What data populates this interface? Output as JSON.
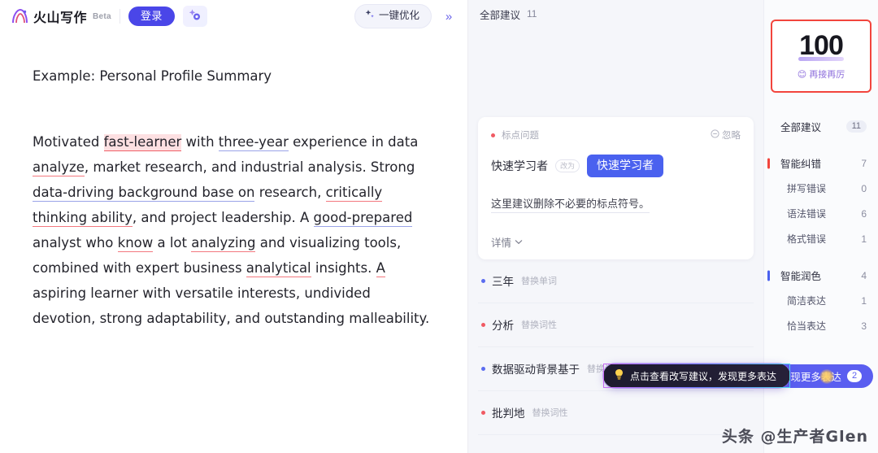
{
  "app": {
    "brand_name": "火山写作",
    "beta_tag": "Beta",
    "login_label": "登录",
    "wand_icon": "magic-wand-icon",
    "optimize_label": "一键优化",
    "optimize_icon": "sparkle-icon",
    "expand_icon": "chevron-double-right-icon"
  },
  "document": {
    "title": "Example: Personal Profile Summary",
    "paragraph_segments": [
      {
        "text": "Motivated ",
        "mark": "none"
      },
      {
        "text": "fast-learner",
        "mark": "red-highlight"
      },
      {
        "text": " with ",
        "mark": "none"
      },
      {
        "text": "three-year",
        "mark": "blue"
      },
      {
        "text": " experience in data ",
        "mark": "none"
      },
      {
        "text": "analyze",
        "mark": "red"
      },
      {
        "text": ", market research, and industrial analysis. Strong ",
        "mark": "none"
      },
      {
        "text": "data-driving background base on",
        "mark": "blue"
      },
      {
        "text": " research, ",
        "mark": "none"
      },
      {
        "text": "critically thinking ability",
        "mark": "red"
      },
      {
        "text": ", and project leadership. A ",
        "mark": "none"
      },
      {
        "text": "good-prepared",
        "mark": "blue"
      },
      {
        "text": " analyst who ",
        "mark": "none"
      },
      {
        "text": "know",
        "mark": "red"
      },
      {
        "text": " a lot ",
        "mark": "none"
      },
      {
        "text": "analyzing",
        "mark": "red"
      },
      {
        "text": " and visualizing tools, combined with expert business ",
        "mark": "none"
      },
      {
        "text": "analytical",
        "mark": "red"
      },
      {
        "text": " insights. ",
        "mark": "none"
      },
      {
        "text": "A",
        "mark": "red"
      },
      {
        "text": " aspiring learner with versatile interests, undivided devotion, strong adaptability, and outstanding malleability.",
        "mark": "none"
      }
    ]
  },
  "suggestions": {
    "header_label": "全部建议",
    "header_count": "11",
    "card": {
      "type_label": "标点问题",
      "type_dot": "red",
      "ignore_label": "忽略",
      "ignore_icon": "minus-circle-icon",
      "old_text": "快速学习者",
      "arrow_label": "改为",
      "new_text": "快速学习者",
      "description": "这里建议删除不必要的标点符号。",
      "more_label": "详情",
      "more_icon": "chevron-down-icon"
    },
    "items": [
      {
        "label": "三年",
        "tag": "替换单词",
        "dot": "blue"
      },
      {
        "label": "分析",
        "tag": "替换词性",
        "dot": "red"
      },
      {
        "label": "数据驱动背景基于",
        "tag": "替换词组",
        "dot": "blue"
      },
      {
        "label": "批判地",
        "tag": "替换词性",
        "dot": "red"
      }
    ],
    "tooltip": {
      "icon": "lightbulb-icon",
      "text": "点击查看改写建议，发现更多表达"
    }
  },
  "score_panel": {
    "score": "100",
    "label": "再接再厉",
    "label_icon": "smile-emoji"
  },
  "categories": [
    {
      "name": "全部建议",
      "count": "11",
      "bar": "none",
      "style": "pill",
      "sub": false
    },
    {
      "name": "智能纠错",
      "count": "7",
      "bar": "red",
      "style": "plain",
      "sub": false
    },
    {
      "name": "拼写错误",
      "count": "0",
      "bar": "none",
      "style": "plain",
      "sub": true
    },
    {
      "name": "语法错误",
      "count": "6",
      "bar": "none",
      "style": "plain",
      "sub": true
    },
    {
      "name": "格式错误",
      "count": "1",
      "bar": "none",
      "style": "plain",
      "sub": true
    },
    {
      "name": "智能润色",
      "count": "4",
      "bar": "blue",
      "style": "plain",
      "sub": false
    },
    {
      "name": "简洁表达",
      "count": "1",
      "bar": "none",
      "style": "plain",
      "sub": true
    },
    {
      "name": "恰当表达",
      "count": "3",
      "bar": "none",
      "style": "plain",
      "sub": true
    }
  ],
  "discover": {
    "label": "发现更多表达",
    "badge": "2",
    "cursor_icon": "mouse-pointer-icon"
  },
  "watermark": "头条 @生产者Glen",
  "colors": {
    "primary": "#4a46e8",
    "accent_blue": "#4a61ef",
    "error_red": "#f2453d",
    "score_purple": "#8e6fdc"
  }
}
